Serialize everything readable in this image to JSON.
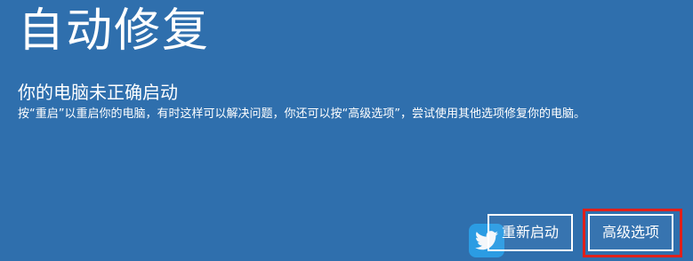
{
  "screen": {
    "title": "自动修复",
    "subtitle": "你的电脑未正确启动",
    "message": "按“重启”以重启你的电脑，有时这样可以解决问题，你还可以按“高级选项”，尝试使用其他选项修复你的电脑。"
  },
  "buttons": {
    "restart_label": "重新启动",
    "advanced_label": "高级选项"
  },
  "watermark": {
    "icon": "twitter-bird-icon"
  },
  "colors": {
    "background": "#2f6fad",
    "highlight": "#e0201a"
  }
}
